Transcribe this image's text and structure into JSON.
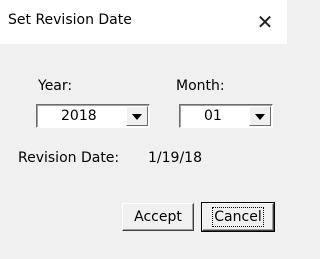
{
  "window": {
    "title": "Set Revision Date",
    "close_glyph": "✕"
  },
  "form": {
    "year_label": "Year:",
    "year_value": "2018",
    "month_label": "Month:",
    "month_value": "01",
    "revision_label": "Revision Date:",
    "revision_value": "1/19/18"
  },
  "buttons": {
    "accept": "Accept",
    "cancel": "Cancel"
  },
  "icons": {
    "close": "close-icon",
    "dropdown": "chevron-down-icon"
  }
}
